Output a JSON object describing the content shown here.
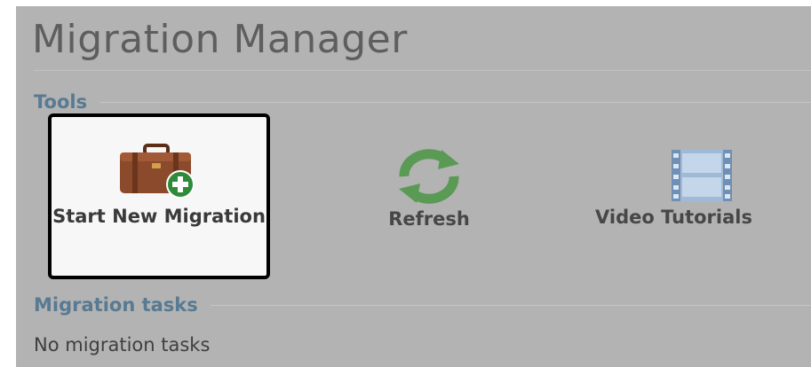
{
  "header": {
    "title": "Migration Manager"
  },
  "tools_section": {
    "label": "Tools",
    "items": [
      {
        "id": "start",
        "label": "Start New Migration",
        "icon": "briefcase-add-icon",
        "selected": true
      },
      {
        "id": "refresh",
        "label": "Refresh",
        "icon": "refresh-icon",
        "selected": false
      },
      {
        "id": "video",
        "label": "Video Tutorials",
        "icon": "film-strip-icon",
        "selected": false
      }
    ]
  },
  "tasks_section": {
    "label": "Migration tasks",
    "empty_message": "No migration tasks"
  },
  "colors": {
    "panel_bg": "#b3b3b3",
    "section_label": "#587a92",
    "title_text": "#5e5e5e",
    "selected_border": "#000000",
    "selected_bg": "#f7f7f7",
    "briefcase": "#8b4a2b",
    "add_badge": "#2e8b3a",
    "refresh_arrows": "#5a9a55",
    "film": "#88a6c8"
  }
}
